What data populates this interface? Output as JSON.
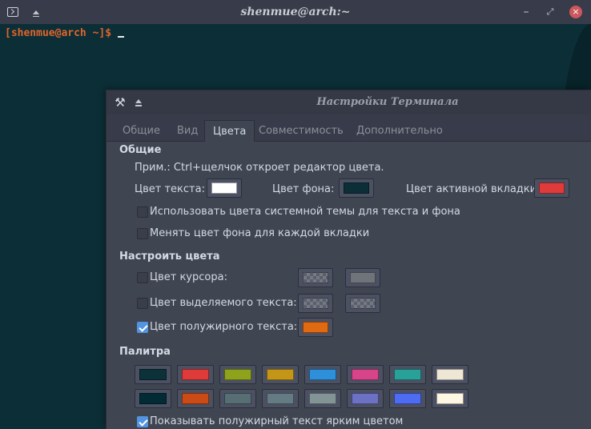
{
  "window": {
    "title": "shenmue@arch:~",
    "prompt": "[shenmue@arch ~]$"
  },
  "dialog": {
    "title": "Настройки Терминала",
    "tabs": [
      {
        "label": "Общие"
      },
      {
        "label": "Вид"
      },
      {
        "label": "Цвета"
      },
      {
        "label": "Совместимость"
      },
      {
        "label": "Дополнительно"
      }
    ],
    "general": {
      "heading": "Общие",
      "hint": "Прим.: Ctrl+щелчок откроет редактор цвета.",
      "text_color_label": "Цвет текста:",
      "text_color": "#ffffff",
      "bg_color_label": "Цвет фона:",
      "bg_color": "#0c2f37",
      "active_tab_color_label": "Цвет активной вкладки:",
      "active_tab_color": "#e03b3b",
      "use_system_colors": {
        "label": "Использовать цвета системной темы для текста и фона",
        "checked": false
      },
      "vary_bg_per_tab": {
        "label": "Менять цвет фона для каждой вкладки",
        "checked": false
      }
    },
    "custom": {
      "heading": "Настроить цвета",
      "cursor": {
        "label": "Цвет курсора:",
        "checked": false,
        "color": "#6f737a"
      },
      "selection": {
        "label": "Цвет выделяемого текста:",
        "checked": false
      },
      "bold": {
        "label": "Цвет полужирного текста:",
        "checked": true,
        "color": "#e06a12"
      }
    },
    "palette": {
      "heading": "Палитра",
      "row1": [
        "#0c3139",
        "#e03b3b",
        "#8ea21b",
        "#c39618",
        "#2e8fdb",
        "#d8448a",
        "#2aa198",
        "#eee7d6"
      ],
      "row2": [
        "#022b36",
        "#cb4b16",
        "#586e75",
        "#657b83",
        "#839496",
        "#6c71c4",
        "#4e6cf2",
        "#fdf6e3"
      ],
      "bold_bright": {
        "label": "Показывать полужирный текст ярким цветом",
        "checked": true
      }
    }
  }
}
